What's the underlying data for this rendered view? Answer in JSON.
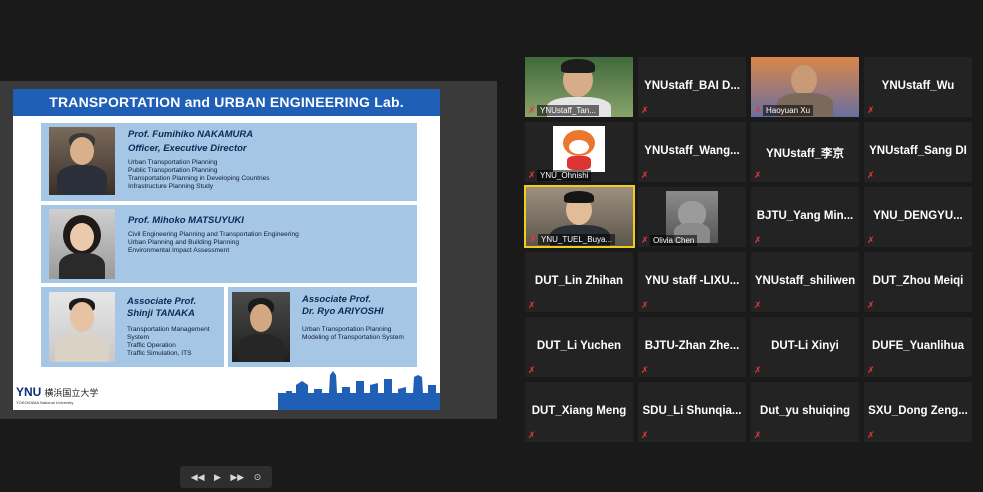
{
  "slide": {
    "title": "TRANSPORTATION and URBAN ENGINEERING Lab.",
    "people": [
      {
        "name": "Prof. Fumihiko NAKAMURA",
        "role": "Officer, Executive Director",
        "topics": [
          "Urban Transportation Planning",
          "Public Transportation Planning",
          "Transportation Planning in Developing Countries",
          "Infrastructure Planning Study"
        ]
      },
      {
        "name": "Prof. Mihoko MATSUYUKI",
        "topics": [
          "Civil Engineering Planning and Transportation Engineering",
          "Urban Planning and Building Planning",
          "Environmental Impact Assessment"
        ]
      },
      {
        "name_line1": "Associate Prof.",
        "name_line2": "Shinji TANAKA",
        "topics": [
          "Transportation Management",
          "System",
          "Traffic Operation",
          "Traffic Simulation, ITS"
        ]
      },
      {
        "name_line1": "Associate Prof.",
        "name_line2": "Dr. Ryo ARIYOSHI",
        "topics": [
          "Urban Transportation Planning",
          "Modeling of Transportation System"
        ]
      }
    ],
    "logo": {
      "abbr": "YNU",
      "jp": "横浜国立大学",
      "en": "YOKOHAMA National University"
    }
  },
  "controls": {
    "prev": "◀◀",
    "play": "▶",
    "next": "▶▶",
    "pointer": "⊙"
  },
  "participants": [
    {
      "name": "YNUstaff_Tan...",
      "video": true
    },
    {
      "name": "YNUstaff_BAI  D..."
    },
    {
      "name": "Haoyuan Xu",
      "video": true
    },
    {
      "name": "YNUstaff_Wu"
    },
    {
      "name": "YNU_Ohnishi",
      "video": true
    },
    {
      "name": "YNUstaff_Wang..."
    },
    {
      "name": "YNUstaff_李京"
    },
    {
      "name": "YNUstaff_Sang DI"
    },
    {
      "name": "YNU_TUEL_Buya...",
      "video": true,
      "active": true
    },
    {
      "name": "Olivia Chen",
      "video": true
    },
    {
      "name": "BJTU_Yang  Min..."
    },
    {
      "name": "YNU_DENGYU..."
    },
    {
      "name": "DUT_Lin Zhihan"
    },
    {
      "name": "YNU  staff  -LIXU..."
    },
    {
      "name": "YNUstaff_shiliwen"
    },
    {
      "name": "DUT_Zhou Meiqi"
    },
    {
      "name": "DUT_Li Yuchen"
    },
    {
      "name": "BJTU-Zhan  Zhe..."
    },
    {
      "name": "DUT-Li Xinyi"
    },
    {
      "name": "DUFE_Yuanlihua"
    },
    {
      "name": "DUT_Xiang Meng"
    },
    {
      "name": "SDU_Li  Shunqia..."
    },
    {
      "name": "Dut_yu shuiqing"
    },
    {
      "name": "SXU_Dong  Zeng..."
    }
  ],
  "colors": {
    "active_border": "#f2cc1b",
    "muted_icon": "#e23a3a",
    "slide_header": "#1f5fb5",
    "card": "#a6c6e6"
  }
}
